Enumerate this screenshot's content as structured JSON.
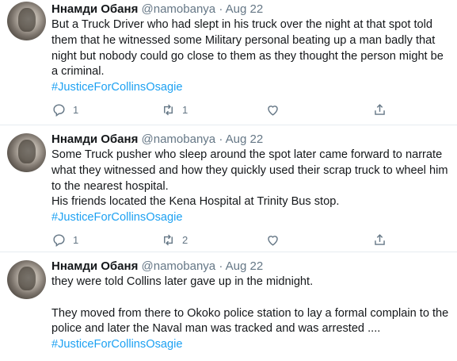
{
  "tweets": [
    {
      "name": "Ннамди Обаня",
      "handle": "@namobanya",
      "separator": "·",
      "date": "Aug 22",
      "text_lines": [
        "But a Truck Driver who had slept in his truck over the night at that spot told them that he witnessed some Military personal beating up a man badly that night but nobody could go close to them as they thought the person might be a criminal."
      ],
      "hashtag": "#JusticeForCollinsOsagie",
      "reply_count": "1",
      "retweet_count": "1"
    },
    {
      "name": "Ннамди Обаня",
      "handle": "@namobanya",
      "separator": "·",
      "date": "Aug 22",
      "text_lines": [
        "Some Truck pusher who sleep around the spot later came forward to narrate what they witnessed and how they quickly used their scrap truck to wheel him to the nearest hospital.",
        "His friends located the Kena Hospital at Trinity Bus stop."
      ],
      "hashtag": "#JusticeForCollinsOsagie",
      "reply_count": "1",
      "retweet_count": "2"
    },
    {
      "name": "Ннамди Обаня",
      "handle": "@namobanya",
      "separator": "·",
      "date": "Aug 22",
      "text_lines": [
        "they were told Collins later gave up in the midnight.",
        "",
        "They moved from there to Okoko police station to lay a formal complain to the police and later the Naval man was tracked and was arrested ...."
      ],
      "hashtag": "#JusticeForCollinsOsagie",
      "reply_count": "",
      "retweet_count": ""
    }
  ],
  "icons": {
    "reply": "reply-icon",
    "retweet": "retweet-icon",
    "like": "heart-icon",
    "share": "share-icon"
  },
  "colors": {
    "hashtag": "#1da1f2",
    "muted": "#657786",
    "divider": "#e6ecf0"
  }
}
